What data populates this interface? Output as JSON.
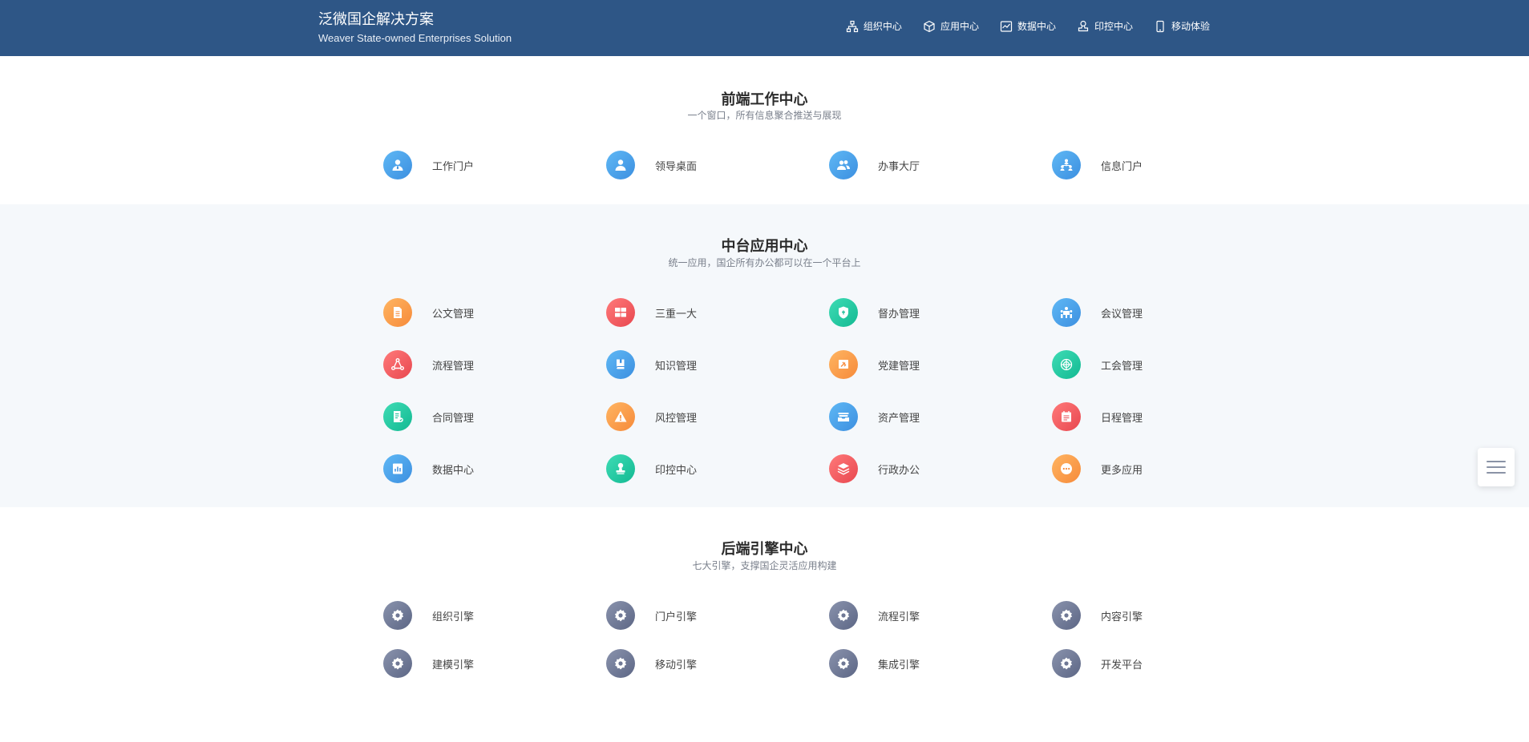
{
  "header": {
    "title": "泛微国企解决方案",
    "subtitle": "Weaver State-owned Enterprises Solution",
    "nav": [
      {
        "label": "组织中心",
        "icon": "org-chart-icon"
      },
      {
        "label": "应用中心",
        "icon": "cube-icon"
      },
      {
        "label": "数据中心",
        "icon": "chart-line-icon"
      },
      {
        "label": "印控中心",
        "icon": "stamp-icon"
      },
      {
        "label": "移动体验",
        "icon": "mobile-icon"
      }
    ]
  },
  "sections": {
    "front": {
      "title": "前端工作中心",
      "subtitle": "一个窗口，所有信息聚合推送与展现",
      "items": [
        {
          "label": "工作门户",
          "icon": "user-tie-icon",
          "color": "blue"
        },
        {
          "label": "领导桌面",
          "icon": "user-icon",
          "color": "blue"
        },
        {
          "label": "办事大厅",
          "icon": "users-icon",
          "color": "blue"
        },
        {
          "label": "信息门户",
          "icon": "org-people-icon",
          "color": "blue"
        }
      ]
    },
    "middle": {
      "title": "中台应用中心",
      "subtitle": "统一应用，国企所有办公都可以在一个平台上",
      "items": [
        {
          "label": "公文管理",
          "icon": "document-icon",
          "color": "orange"
        },
        {
          "label": "三重一大",
          "icon": "grid-blocks-icon",
          "color": "red"
        },
        {
          "label": "督办管理",
          "icon": "shield-icon",
          "color": "green"
        },
        {
          "label": "会议管理",
          "icon": "meeting-icon",
          "color": "blue"
        },
        {
          "label": "流程管理",
          "icon": "flow-icon",
          "color": "red"
        },
        {
          "label": "知识管理",
          "icon": "book-icon",
          "color": "blue"
        },
        {
          "label": "党建管理",
          "icon": "party-flag-icon",
          "color": "orange"
        },
        {
          "label": "工会管理",
          "icon": "union-emblem-icon",
          "color": "green"
        },
        {
          "label": "合同管理",
          "icon": "contract-icon",
          "color": "green"
        },
        {
          "label": "风控管理",
          "icon": "warning-icon",
          "color": "orange"
        },
        {
          "label": "资产管理",
          "icon": "inbox-icon",
          "color": "blue"
        },
        {
          "label": "日程管理",
          "icon": "calendar-icon",
          "color": "red"
        },
        {
          "label": "数据中心",
          "icon": "bar-chart-icon",
          "color": "blue"
        },
        {
          "label": "印控中心",
          "icon": "stamp-icon",
          "color": "green"
        },
        {
          "label": "行政办公",
          "icon": "layers-icon",
          "color": "red"
        },
        {
          "label": "更多应用",
          "icon": "more-icon",
          "color": "orange"
        }
      ]
    },
    "back": {
      "title": "后端引擎中心",
      "subtitle": "七大引擎，支撑国企灵活应用构建",
      "items": [
        {
          "label": "组织引擎",
          "icon": "gear-icon",
          "color": "gray"
        },
        {
          "label": "门户引擎",
          "icon": "gear-icon",
          "color": "gray"
        },
        {
          "label": "流程引擎",
          "icon": "gear-icon",
          "color": "gray"
        },
        {
          "label": "内容引擎",
          "icon": "gear-icon",
          "color": "gray"
        },
        {
          "label": "建模引擎",
          "icon": "gear-icon",
          "color": "gray"
        },
        {
          "label": "移动引擎",
          "icon": "gear-icon",
          "color": "gray"
        },
        {
          "label": "集成引擎",
          "icon": "gear-icon",
          "color": "gray"
        },
        {
          "label": "开发平台",
          "icon": "gear-icon",
          "color": "gray"
        }
      ]
    }
  },
  "float_menu": {
    "icon": "hamburger-menu-icon"
  }
}
